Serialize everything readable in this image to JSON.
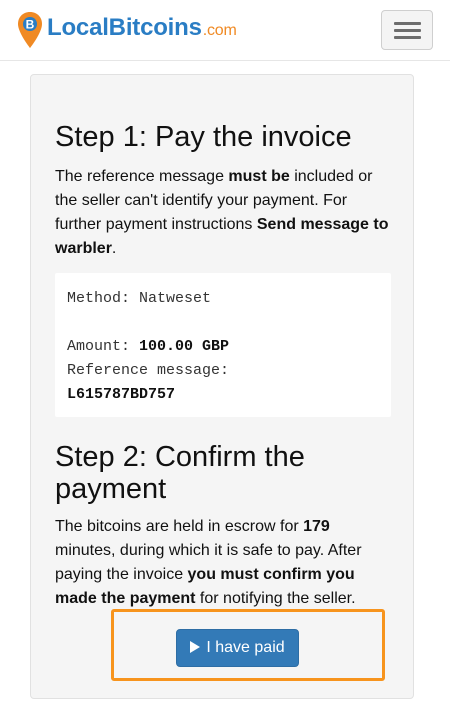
{
  "header": {
    "brand": "LocalBitcoins",
    "brand_domain": ".com",
    "logo_icon": "bitcoin-pin-icon",
    "menu_icon": "hamburger-icon"
  },
  "step1": {
    "title": "Step 1: Pay the invoice",
    "text_a": "The reference message ",
    "text_b": "must be",
    "text_c": " included or the seller can't identify your payment. For further payment instructions ",
    "text_d": "Send message to warbler",
    "text_e": ".",
    "method_label": "Method: ",
    "method_value": "Natweset",
    "amount_label": "Amount: ",
    "amount_value": "100.00 GBP",
    "reference_label": "Reference message:",
    "reference_value": "L615787BD757"
  },
  "step2": {
    "title": "Step 2: Confirm the payment",
    "text_a": "The bitcoins are held in escrow for ",
    "text_b": "179",
    "text_c": " minutes, during which it is safe to pay. After paying the invoice ",
    "text_d": "you must confirm you made the payment",
    "text_e": " for notifying the seller."
  },
  "paid_button": {
    "label": "I have paid",
    "icon": "play-icon"
  },
  "colors": {
    "brand_blue": "#2a7dc4",
    "brand_orange": "#f08a24",
    "button_blue": "#337ab7",
    "highlight_orange": "#f7941d"
  }
}
